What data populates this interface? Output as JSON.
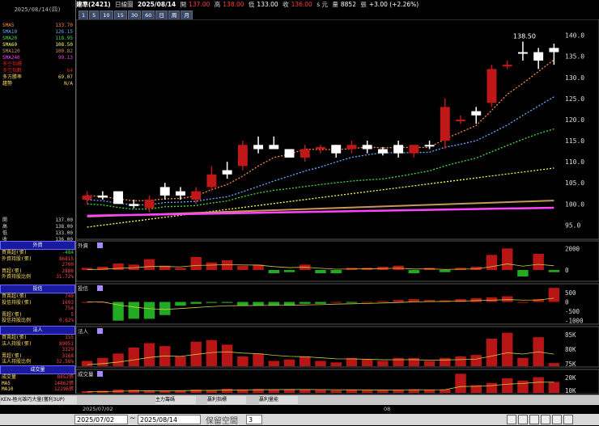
{
  "header": {
    "left_date": "2025/08/14(四)",
    "stock": "建準(2421)",
    "period": "日線圖",
    "date": "2025/08/14",
    "open_lbl": "開",
    "open": "137.00",
    "high_lbl": "高",
    "high": "138.00",
    "low_lbl": "低",
    "low": "133.00",
    "close_lbl": "收",
    "close": "136.00",
    "unit": "s 元",
    "vol_lbl": "量",
    "vol": "8852",
    "chg_lbl": "張",
    "chg": "+3.00 (+2.26%)"
  },
  "timeframes": [
    "1",
    "5",
    "10",
    "15",
    "30",
    "60",
    "日",
    "周",
    "月"
  ],
  "sma": [
    {
      "name": "SMA5",
      "value": "133.70",
      "color": "#ff8a3a"
    },
    {
      "name": "SMA10",
      "value": "126.15",
      "color": "#66aaff"
    },
    {
      "name": "SMA20",
      "value": "118.95",
      "color": "#44dd44"
    },
    {
      "name": "SMA60",
      "value": "108.50",
      "color": "#ffff55"
    },
    {
      "name": "SMA120",
      "value": "100.82",
      "color": "#c8955a"
    },
    {
      "name": "SMA240",
      "value": "99.13",
      "color": "#ff44ff"
    },
    {
      "name": "多空指標",
      "value": "",
      "color": "#dd2222"
    },
    {
      "name": "多空指數",
      "value": "64",
      "color": "#dd2222"
    },
    {
      "name": "多方勝率",
      "value": "69.07",
      "color": "#ffdd66"
    },
    {
      "name": "趨勢",
      "value": "N/A",
      "color": "#ffdd66"
    }
  ],
  "ohlc": [
    {
      "k": "開",
      "v": "137.00"
    },
    {
      "k": "高",
      "v": "138.00"
    },
    {
      "k": "低",
      "v": "133.00"
    },
    {
      "k": "收",
      "v": "136.00"
    }
  ],
  "panels": [
    {
      "title": "外資",
      "rows": [
        [
          "買賣超(張)",
          "-484"
        ],
        [
          "外資持股(張)",
          "86815"
        ],
        [
          "",
          "2700"
        ],
        [
          "買超(張)",
          "2888"
        ],
        [
          "外資持股比例",
          "31.72%"
        ]
      ]
    },
    {
      "title": "投信",
      "rows": [
        [
          "買賣超(張)",
          "749"
        ],
        [
          "投信持股(張)",
          "1693"
        ],
        [
          "",
          "754"
        ],
        [
          "賣超(張)",
          "5"
        ],
        [
          "投信持股比例",
          "0.62%"
        ]
      ]
    },
    {
      "title": "法人",
      "rows": [
        [
          "買賣超(張)",
          "155"
        ],
        [
          "法人持股(張)",
          "89051"
        ],
        [
          "",
          "3329"
        ],
        [
          "賣超(張)",
          "3168"
        ],
        [
          "法人持股比例",
          "32.58%"
        ]
      ]
    },
    {
      "title": "成交量",
      "rows": [
        [
          "成交量",
          "8852張"
        ],
        [
          "MA5",
          "14862張"
        ],
        [
          "MA10",
          "12296張"
        ]
      ]
    }
  ],
  "subpanel_labels": [
    "外資",
    "投信",
    "法人",
    "成交量"
  ],
  "price_axis": [
    "140.0",
    "135.0",
    "130.0",
    "125.0",
    "120.0",
    "115.0",
    "110.0",
    "105.0",
    "100.0",
    "95.0"
  ],
  "high_label": "138.50",
  "axes": {
    "foreign": [
      "2000",
      "0"
    ],
    "trust": [
      "500",
      "0",
      "-500",
      "-1000"
    ],
    "inst": [
      "85K",
      "80K",
      "75K"
    ],
    "vol": [
      "20K",
      "10K"
    ]
  },
  "bottombar": {
    "ken": "KEN-極光雄巧大量(獲利3UP)",
    "b2": "主力籌碼",
    "b3": "贏利指標",
    "b4": "贏利量能"
  },
  "date_axis": {
    "start": "2025/07/02",
    "mid": "08"
  },
  "controls": {
    "from": "2025/07/02",
    "tilde": "~",
    "to": "2025/08/14",
    "keep": "保留空間",
    "num": "3"
  },
  "chart_data": {
    "type": "candlestick",
    "ylim": [
      92,
      143
    ],
    "candles": [
      [
        101,
        103,
        100,
        102,
        "R"
      ],
      [
        102,
        103,
        101,
        101.5,
        "W"
      ],
      [
        103,
        103,
        100,
        100,
        "W"
      ],
      [
        100,
        101,
        99,
        99.5,
        "W"
      ],
      [
        99,
        102,
        98,
        101,
        "R"
      ],
      [
        102,
        105,
        101,
        104,
        "W"
      ],
      [
        103,
        104,
        101,
        102,
        "W"
      ],
      [
        101,
        104,
        100,
        103,
        "R"
      ],
      [
        104,
        109,
        103,
        107,
        "R"
      ],
      [
        108,
        110,
        106,
        107,
        "W"
      ],
      [
        109,
        115,
        108,
        114,
        "R"
      ],
      [
        113,
        116,
        112,
        114,
        "W"
      ],
      [
        114,
        116,
        113,
        113,
        "W"
      ],
      [
        113,
        113,
        111,
        111,
        "W"
      ],
      [
        111,
        114,
        110,
        113,
        "R"
      ],
      [
        113,
        114,
        112,
        113.5,
        "R"
      ],
      [
        112,
        114,
        111,
        114,
        "W"
      ],
      [
        113,
        115,
        112,
        114,
        "R"
      ],
      [
        114,
        115,
        112,
        113,
        "W"
      ],
      [
        113,
        113.5,
        111.5,
        112,
        "W"
      ],
      [
        112,
        115,
        111,
        114,
        "W"
      ],
      [
        112,
        114,
        111,
        114,
        "R"
      ],
      [
        114,
        115,
        113,
        114,
        "W"
      ],
      [
        115,
        125,
        113,
        123,
        "R"
      ],
      [
        120,
        121,
        119,
        120,
        "R"
      ],
      [
        121,
        123,
        119,
        122,
        "W"
      ],
      [
        124,
        133,
        123,
        132,
        "R"
      ],
      [
        133,
        134,
        132,
        133,
        "R"
      ],
      [
        136,
        138.5,
        134,
        136,
        "W"
      ],
      [
        136,
        137,
        132,
        134,
        "W"
      ],
      [
        137,
        138,
        133,
        136,
        "W"
      ]
    ],
    "foreign": [
      200,
      300,
      600,
      500,
      1000,
      400,
      200,
      1200,
      700,
      900,
      400,
      500,
      -300,
      -200,
      500,
      -300,
      -300,
      200,
      200,
      300,
      400,
      -300,
      200,
      -200,
      200,
      300,
      1400,
      2000,
      -600,
      1500,
      -200
    ],
    "trust": [
      0,
      0,
      -1000,
      -900,
      -900,
      -700,
      -200,
      -100,
      -50,
      -50,
      -200,
      -200,
      -200,
      -200,
      -100,
      -100,
      0,
      -50,
      0,
      50,
      100,
      150,
      100,
      80,
      150,
      200,
      250,
      300,
      0,
      150,
      750
    ],
    "inst": [
      300,
      500,
      800,
      1200,
      1500,
      1300,
      600,
      1600,
      1700,
      1400,
      600,
      800,
      300,
      400,
      600,
      300,
      200,
      500,
      400,
      300,
      500,
      500,
      300,
      500,
      600,
      700,
      1800,
      2200,
      500,
      1900,
      155
    ],
    "vol": [
      800,
      1200,
      2200,
      2000,
      1500,
      1400,
      1300,
      2200,
      1700,
      2800,
      2300,
      2700,
      2300,
      2600,
      2200,
      2000,
      1400,
      1900,
      1600,
      1500,
      2100,
      2400,
      1800,
      2400,
      16000,
      6000,
      8000,
      12000,
      10000,
      13000,
      8852
    ]
  }
}
